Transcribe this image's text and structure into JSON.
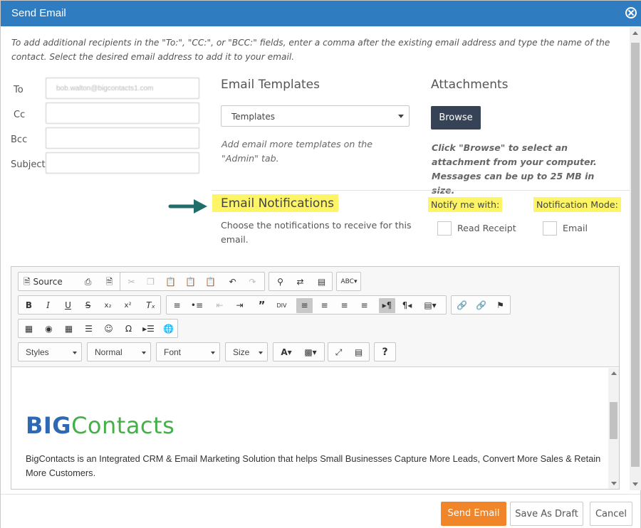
{
  "dialog": {
    "title": "Send Email"
  },
  "help_text": "To add additional recipients in the \"To:\", \"CC:\", or \"BCC:\" fields, enter a comma after the existing email address and type the name of the contact. Select the desired email address to add it to your email.",
  "fields": {
    "to_label": "To",
    "to_value": "bob.walton@bigcontacts1.com",
    "cc_label": "Cc",
    "bcc_label": "Bcc",
    "subject_label": "Subject"
  },
  "templates": {
    "title": "Email Templates",
    "selected": "Templates",
    "hint": "Add email more templates on the \"Admin\" tab."
  },
  "attachments": {
    "title": "Attachments",
    "browse_label": "Browse",
    "hint": "Click \"Browse\" to select an attachment from your computer. Messages can be up to 25 MB in size."
  },
  "notifications": {
    "title": "Email Notifications",
    "description": "Choose the notifications to receive for this email.",
    "notify_label": "Notify me with:",
    "mode_label": "Notification Mode:",
    "read_receipt_label": "Read Receipt",
    "email_label": "Email"
  },
  "editor": {
    "source_label": "Source",
    "styles_label": "Styles",
    "format_label": "Normal",
    "font_label": "Font",
    "size_label": "Size",
    "logo_part1": "BIG",
    "logo_part2": "Contacts",
    "body": "BigContacts is an Integrated CRM & Email Marketing Solution that helps Small Businesses Capture More Leads, Convert More Sales & Retain More Customers."
  },
  "footer": {
    "send_label": "Send Email",
    "draft_label": "Save As Draft",
    "cancel_label": "Cancel"
  },
  "colors": {
    "titlebar": "#2f7dc0",
    "send_button": "#f0852a",
    "browse_button": "#364357",
    "highlight": "#fdf566",
    "arrow": "#1f6e6a"
  }
}
